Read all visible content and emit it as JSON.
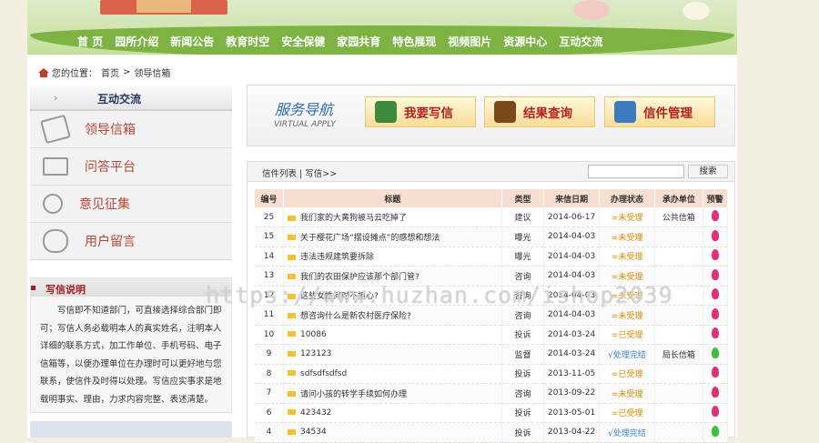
{
  "nav": [
    "首 页",
    "园所介绍",
    "新闻公告",
    "教育时空",
    "安全保健",
    "家园共育",
    "特色展现",
    "视频图片",
    "资源中心",
    "互动交流"
  ],
  "breadcrumb": {
    "prefix": "您的位置：",
    "home": "首页",
    "sep": ">",
    "current": "领导信箱"
  },
  "sidebar": {
    "title": "互动交流",
    "arrow": "›",
    "items": [
      {
        "label": "领导信箱",
        "icon": "speech-bubble-icon"
      },
      {
        "label": "问答平台",
        "icon": "pencil-paper-icon"
      },
      {
        "label": "意见征集",
        "icon": "people-screen-icon"
      },
      {
        "label": "用户留言",
        "icon": "magnifier-icon"
      }
    ]
  },
  "letter_info": {
    "title": "写信说明",
    "body": "写信即不知道部门，可直接选择综合部门即可；写信人务必载明本人的真实姓名，注明本人详细的联系方式，加工作单位、手机号码、电子信箱等，以便办理单位在办理时可以更好地与您联系，使信件及时得以处理。写信应实事求是地载明事实、理由，力求内容完整、表述清楚。"
  },
  "service": {
    "title": "服务导航",
    "subtitle": "VIRTUAL APPLY",
    "buttons": [
      {
        "label": "我要写信",
        "icon": "person-icon",
        "color": "#3d8a3d"
      },
      {
        "label": "结果查询",
        "icon": "briefcase-icon",
        "color": "#7a4a1c"
      },
      {
        "label": "信件管理",
        "icon": "globe-icon",
        "color": "#3b7bbf"
      }
    ]
  },
  "list": {
    "tabs": "信件列表 | 写信>>",
    "search_placeholder": "",
    "search_button": "搜索",
    "headers": [
      "编号",
      "标题",
      "类型",
      "来信日期",
      "办理状态",
      "承办单位",
      "预警"
    ],
    "rows": [
      {
        "id": "25",
        "title": "我们家的大黄狗被马云吃掉了",
        "type": "建议",
        "date": "2014-06-17",
        "status": "=未受理",
        "unit": "公共信箱",
        "warn": "#e0307a"
      },
      {
        "id": "15",
        "title": "关于樱花广场“摆设摊点”的感想和想法",
        "type": "曝光",
        "date": "2014-04-03",
        "status": "=未受理",
        "unit": "",
        "warn": "#e0307a"
      },
      {
        "id": "14",
        "title": "违法违规建筑要拆除",
        "type": "曝光",
        "date": "2014-04-03",
        "status": "=未受理",
        "unit": "",
        "warn": "#e0307a"
      },
      {
        "id": "13",
        "title": "我们的农田保护应该那个部门管?",
        "type": "咨询",
        "date": "2014-04-03",
        "status": "=未受理",
        "unit": "",
        "warn": "#e0307a"
      },
      {
        "id": "12",
        "title": "这些女性何时不担心?",
        "type": "咨询",
        "date": "2014-04-03",
        "status": "=未受理",
        "unit": "",
        "warn": "#e0307a"
      },
      {
        "id": "11",
        "title": "想咨询什么是新农村医疗保险?",
        "type": "咨询",
        "date": "2014-04-03",
        "status": "=未受理",
        "unit": "",
        "warn": "#e0307a"
      },
      {
        "id": "10",
        "title": "10086",
        "type": "投诉",
        "date": "2014-03-24",
        "status": "=已受理",
        "unit": "",
        "warn": "#e0307a"
      },
      {
        "id": "9",
        "title": "123123",
        "type": "监督",
        "date": "2014-03-24",
        "status": "√处理完结",
        "unit": "局长信箱",
        "warn": "#3cbf3c"
      },
      {
        "id": "8",
        "title": "sdfsdfsdfsd",
        "type": "投诉",
        "date": "2013-11-05",
        "status": "=已受理",
        "unit": "",
        "warn": "#e0307a"
      },
      {
        "id": "7",
        "title": "请问小孩的转学手续如何办理",
        "type": "咨询",
        "date": "2013-09-22",
        "status": "=未受理",
        "unit": "",
        "warn": "#e0307a"
      },
      {
        "id": "6",
        "title": "423432",
        "type": "投诉",
        "date": "2013-05-01",
        "status": "=已受理",
        "unit": "",
        "warn": "#e0307a"
      },
      {
        "id": "4",
        "title": "34534",
        "type": "投诉",
        "date": "2013-04-22",
        "status": "√处理完结",
        "unit": "",
        "warn": "#3cbf3c"
      }
    ]
  },
  "watermark": "https://www.huzhan.com/ishop2039"
}
